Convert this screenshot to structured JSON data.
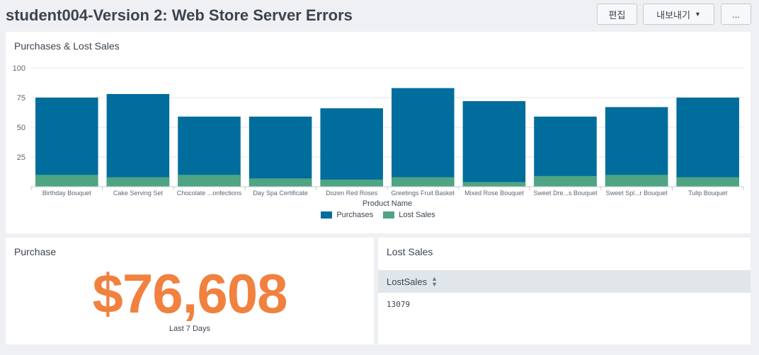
{
  "header": {
    "title": "student004-Version 2: Web Store Server Errors",
    "edit_label": "편집",
    "export_label": "내보내기",
    "more_label": "..."
  },
  "chart_panel": {
    "title": "Purchases & Lost Sales",
    "legend": [
      "Purchases",
      "Lost Sales"
    ]
  },
  "chart_data": {
    "type": "bar",
    "title": "Purchases & Lost Sales",
    "xlabel": "Product Name",
    "ylabel": "",
    "ylim": [
      0,
      100
    ],
    "yticks": [
      25,
      50,
      75,
      100
    ],
    "stacked": false,
    "categories": [
      "Birthday Bouquet",
      "Cake Serving Set",
      "Chocolate ...onfections",
      "Day Spa Certificate",
      "Dozen Red Roses",
      "Greetings Fruit Basket",
      "Mixed Rose Bouquet",
      "Sweet Dre...s Bouquet",
      "Sweet Spl...r Bouquet",
      "Tulip Bouquet"
    ],
    "series": [
      {
        "name": "Purchases",
        "color": "#006d9c",
        "values": [
          75,
          78,
          59,
          59,
          66,
          83,
          72,
          59,
          67,
          75
        ]
      },
      {
        "name": "Lost Sales",
        "color": "#4fa484",
        "values": [
          10,
          8,
          10,
          7,
          6,
          8,
          4,
          9,
          10,
          8
        ]
      }
    ],
    "grid": true,
    "legend_position": "bottom"
  },
  "purchase_panel": {
    "title": "Purchase",
    "value": "$76,608",
    "subtext": "Last 7 Days",
    "value_color": "#f1813f"
  },
  "lost_panel": {
    "title": "Lost Sales",
    "column_header": "LostSales",
    "rows": [
      "13079"
    ]
  }
}
